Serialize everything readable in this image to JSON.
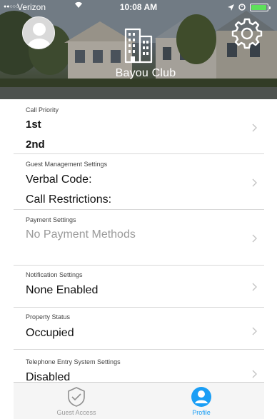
{
  "status_bar": {
    "carrier": "Verizon",
    "time": "10:08 AM"
  },
  "header": {
    "club_name": "Bayou Club"
  },
  "sections": {
    "call_priority": {
      "title": "Call Priority",
      "first": "1st",
      "second": "2nd"
    },
    "guest_management": {
      "title": "Guest Management Settings",
      "verbal_code": "Verbal Code:",
      "call_restrictions": "Call Restrictions:"
    },
    "payment": {
      "title": "Payment Settings",
      "value": "No Payment Methods"
    },
    "notification": {
      "title": "Notification Settings",
      "value": "None Enabled"
    },
    "property_status": {
      "title": "Property Status",
      "value": "Occupied"
    },
    "telephone_entry": {
      "title": "Telephone Entry System Settings",
      "value": "Disabled"
    }
  },
  "tab_bar": {
    "tabs": [
      {
        "label": "Guest Access",
        "icon": "shield-check-icon",
        "active": false
      },
      {
        "label": "Profile",
        "icon": "person-circle-icon",
        "active": true
      }
    ]
  },
  "colors": {
    "accent": "#1a9ef5",
    "inactive": "#9a9a9a",
    "battery": "#5de05a"
  }
}
